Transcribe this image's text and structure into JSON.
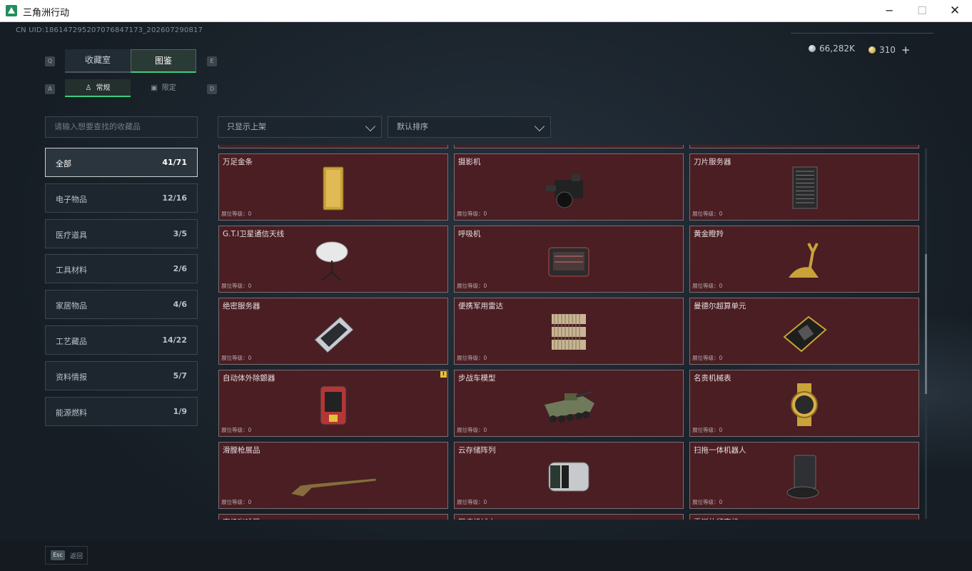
{
  "window": {
    "title": "三角洲行动"
  },
  "header": {
    "uid": "CN UID:1861472952070768471​73_202607290817",
    "currency_silver": "66,282K",
    "currency_gold": "310",
    "plus": "+"
  },
  "keys": {
    "tab_prev": "Q",
    "tab_next": "E",
    "sub_prev": "A",
    "sub_next": "D"
  },
  "tabs": [
    {
      "label": "收藏室",
      "active": false
    },
    {
      "label": "图鉴",
      "active": true
    }
  ],
  "subtabs": [
    {
      "label": "常规",
      "active": true
    },
    {
      "label": "限定",
      "active": false
    }
  ],
  "search": {
    "placeholder": "请输入想要查找的收藏品"
  },
  "filters": {
    "show": "只显示上架",
    "sort": "默认排序"
  },
  "categories": [
    {
      "label": "全部",
      "count": "41/71",
      "active": true
    },
    {
      "label": "电子物品",
      "count": "12/16"
    },
    {
      "label": "医疗道具",
      "count": "3/5"
    },
    {
      "label": "工具材料",
      "count": "2/6"
    },
    {
      "label": "家居物品",
      "count": "4/6"
    },
    {
      "label": "工艺藏品",
      "count": "14/22"
    },
    {
      "label": "资料情报",
      "count": "5/7"
    },
    {
      "label": "能源燃料",
      "count": "1/9"
    }
  ],
  "level_label": "展位等级：0",
  "items": [
    {
      "name": "万足金条",
      "icon": "gold-bar-icon"
    },
    {
      "name": "摄影机",
      "icon": "camera-icon"
    },
    {
      "name": "刀片服务器",
      "icon": "blade-server-icon"
    },
    {
      "name": "G.T.I卫星通信天线",
      "icon": "satellite-dish-icon"
    },
    {
      "name": "呼吸机",
      "icon": "ventilator-icon"
    },
    {
      "name": "黄金瞪羚",
      "icon": "golden-gazelle-icon"
    },
    {
      "name": "绝密服务器",
      "icon": "secret-server-icon"
    },
    {
      "name": "便携军用雷达",
      "icon": "portable-radar-icon"
    },
    {
      "name": "曼德尔超算单元",
      "icon": "supercomputer-unit-icon"
    },
    {
      "name": "自动体外除颤器",
      "icon": "defibrillator-icon",
      "warn": "!"
    },
    {
      "name": "步战车模型",
      "icon": "ifv-model-icon"
    },
    {
      "name": "名贵机械表",
      "icon": "luxury-watch-icon"
    },
    {
      "name": "滑膛枪展品",
      "icon": "musket-icon"
    },
    {
      "name": "云存储阵列",
      "icon": "storage-array-icon"
    },
    {
      "name": "扫拖一体机器人",
      "icon": "robot-vacuum-icon"
    },
    {
      "name": "高级咖啡豆",
      "icon": "coffee-bean-icon"
    },
    {
      "name": "医疗机械人",
      "icon": "medical-robot-icon"
    },
    {
      "name": "雷斯的留声机",
      "icon": "gramophone-icon"
    }
  ],
  "footer": {
    "esc_key": "Esc",
    "back_label": "返回"
  }
}
